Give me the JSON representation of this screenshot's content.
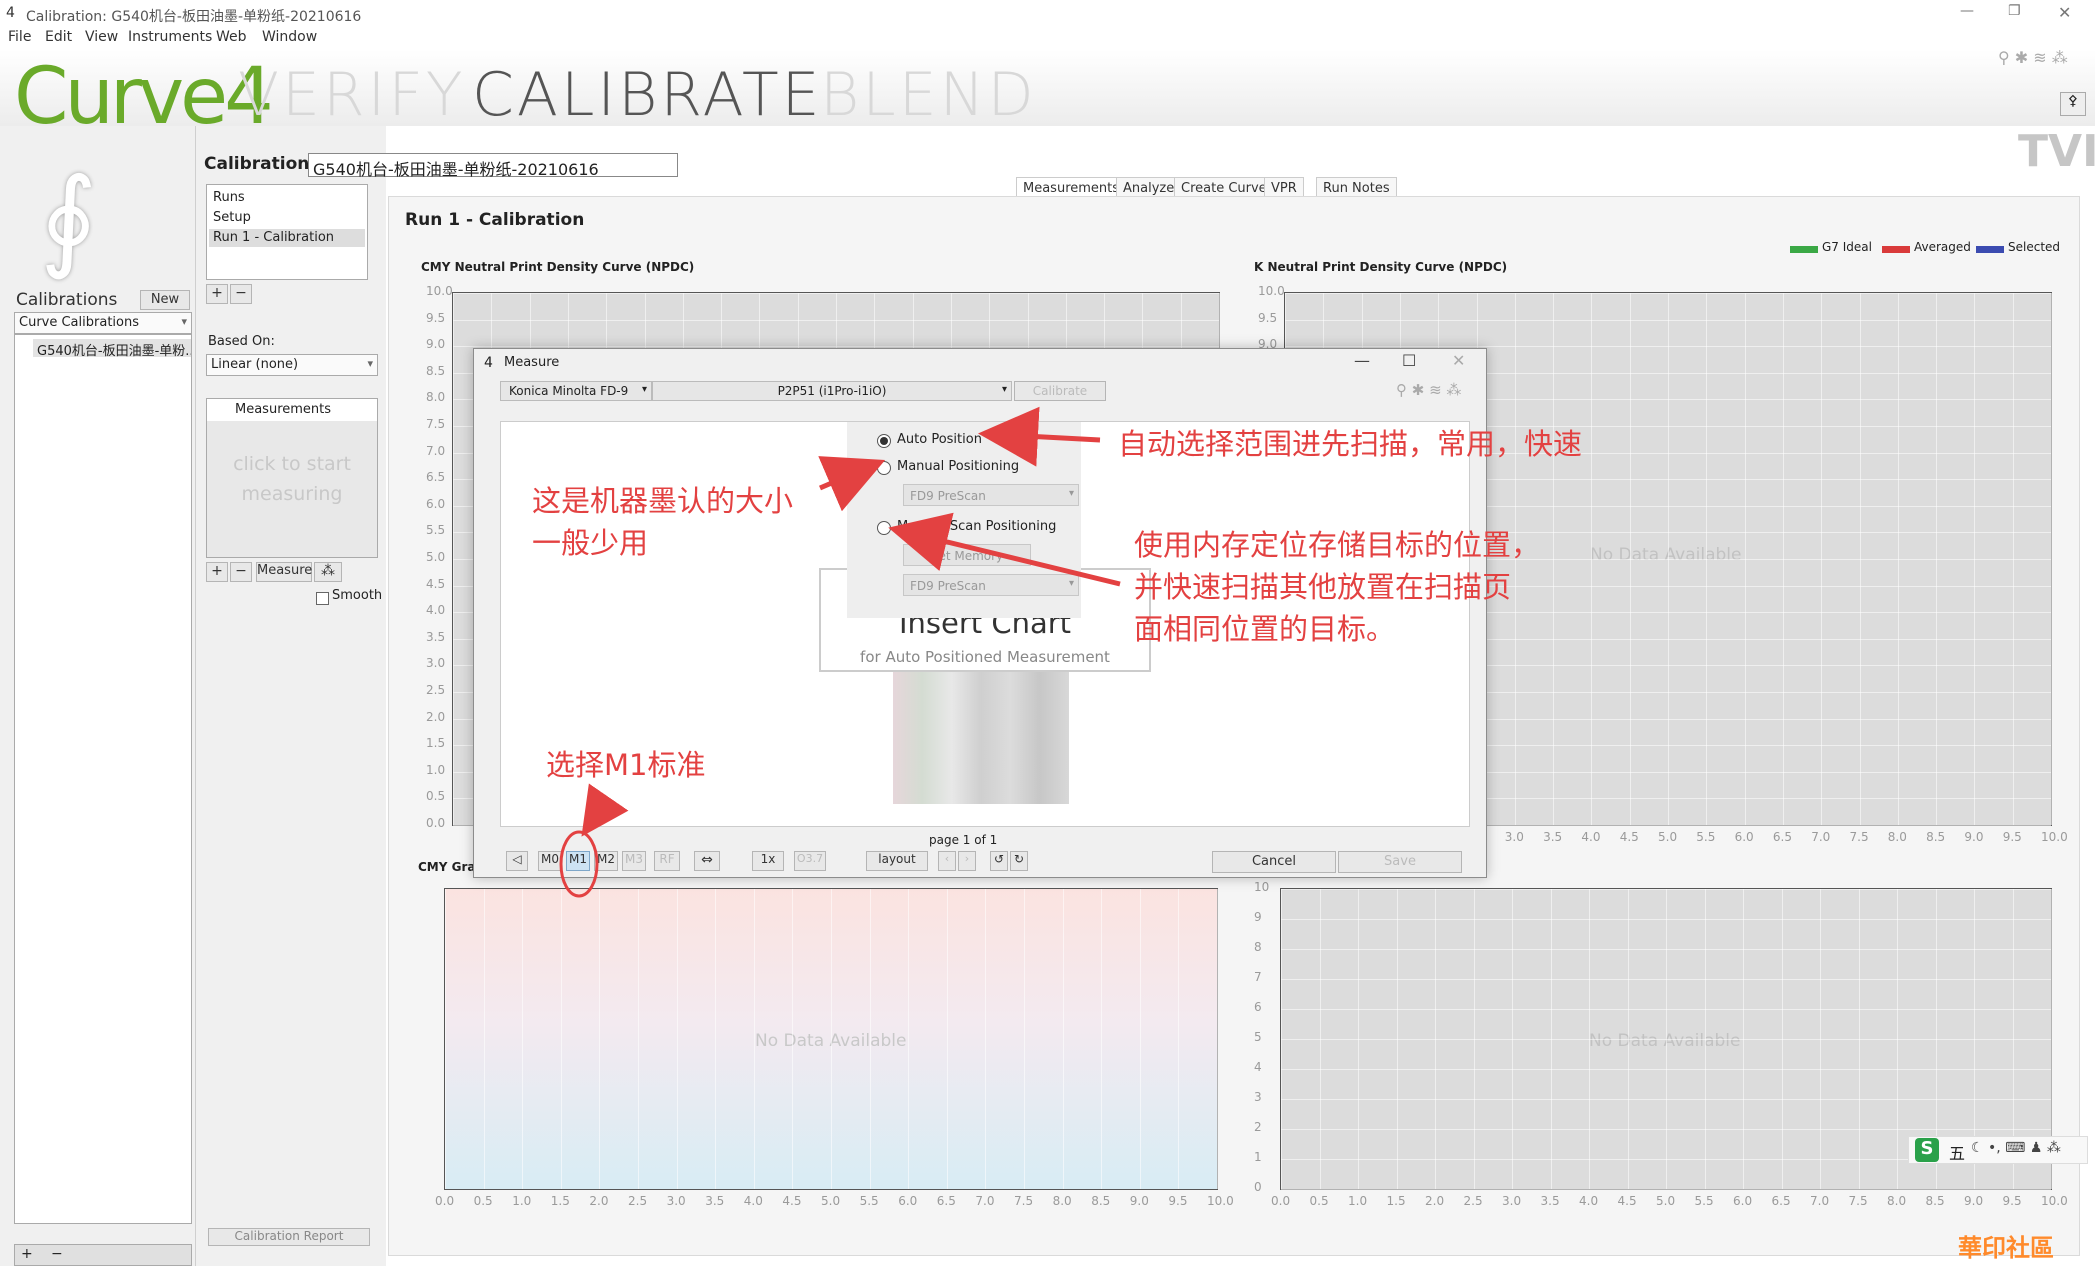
{
  "window": {
    "title": "Calibration: G540机台-板田油墨-单粉纸-20210616"
  },
  "menu": [
    "File",
    "Edit",
    "View",
    "Instruments",
    "Web",
    "Window"
  ],
  "banner": {
    "logo": "Curve4",
    "nav": [
      "VERIFY",
      "CALIBRATE",
      "BLEND"
    ],
    "tvi": "TVI"
  },
  "left": {
    "calibrations_label": "Calibrations",
    "new_button": "New",
    "dropdown": "Curve Calibrations",
    "items": [
      "G540机台-板田油墨-单粉..."
    ]
  },
  "calibration": {
    "label": "Calibration:",
    "name": "G540机台-板田油墨-单粉纸-20210616"
  },
  "runs": {
    "items": [
      "Runs",
      "Setup",
      "Run 1 - Calibration"
    ]
  },
  "based_on": {
    "label": "Based On:",
    "value": "Linear (none)"
  },
  "measurements": {
    "header": "Measurements",
    "placeholder": "click to start measuring",
    "measure_button": "Measure",
    "smooth": "Smooth",
    "report_button": "Calibration Report"
  },
  "tabs": [
    "Measurements",
    "Analyze",
    "Create Curves",
    "VPR",
    "Run Notes"
  ],
  "run_title": "Run 1 - Calibration",
  "legend": [
    {
      "name": "G7 Ideal",
      "color": "#3aa845"
    },
    {
      "name": "Averaged",
      "color": "#d93a3a"
    },
    {
      "name": "Selected",
      "color": "#3b4bb0"
    }
  ],
  "charts": {
    "cmy_title": "CMY Neutral Print Density Curve (NPDC)",
    "k_title": "K Neutral Print Density Curve (NPDC)",
    "cmy_gray_title": "CMY Gray",
    "no_data": "No Data Available",
    "y_ticks": [
      "10.0",
      "9.5",
      "9.0",
      "8.5",
      "8.0",
      "7.5",
      "7.0",
      "6.5",
      "6.0",
      "5.5",
      "5.0",
      "4.5",
      "4.0",
      "3.5",
      "3.0",
      "2.5",
      "2.0",
      "1.5",
      "1.0",
      "0.5",
      "0.0"
    ],
    "x_ticks": [
      "0.0",
      "0.5",
      "1.0",
      "1.5",
      "2.0",
      "2.5",
      "3.0",
      "3.5",
      "4.0",
      "4.5",
      "5.0",
      "5.5",
      "6.0",
      "6.5",
      "7.0",
      "7.5",
      "8.0",
      "8.5",
      "9.0",
      "9.5",
      "10.0"
    ],
    "y_ticks_int": [
      "10",
      "9",
      "8",
      "7",
      "6",
      "5",
      "4",
      "3",
      "2",
      "1",
      "0"
    ]
  },
  "dialog": {
    "title": "Measure",
    "instrument": "Konica Minolta FD-9",
    "chart": "P2P51 (i1Pro-i1iO)",
    "calibrate_btn": "Calibrate",
    "options": [
      "Auto Position",
      "Manual Positioning",
      "MemoryScan Positioning"
    ],
    "prescan1": "FD9 PreScan",
    "set_memory": "Set Memory",
    "prescan2": "FD9 PreScan",
    "insert_chart": "Insert Chart",
    "insert_sub": "for Auto Positioned Measurement",
    "page": "page 1 of 1",
    "modes": [
      "M0",
      "M1",
      "M2",
      "M3"
    ],
    "rf": "RF",
    "speed": "1x",
    "o3": "O3.7",
    "layout": "layout",
    "cancel": "Cancel",
    "save": "Save"
  },
  "annotations": {
    "auto": "自动选择范围进先扫描，常用，快速",
    "machine": "这是机器墨认的大小\n一般少用",
    "memory": "使用内存定位存储目标的位置，\n并快速扫描其他放置在扫描页\n面相同位置的目标。",
    "m1": "选择M1标准"
  },
  "ime": {
    "mode": "五"
  },
  "watermark": "華印社區"
}
